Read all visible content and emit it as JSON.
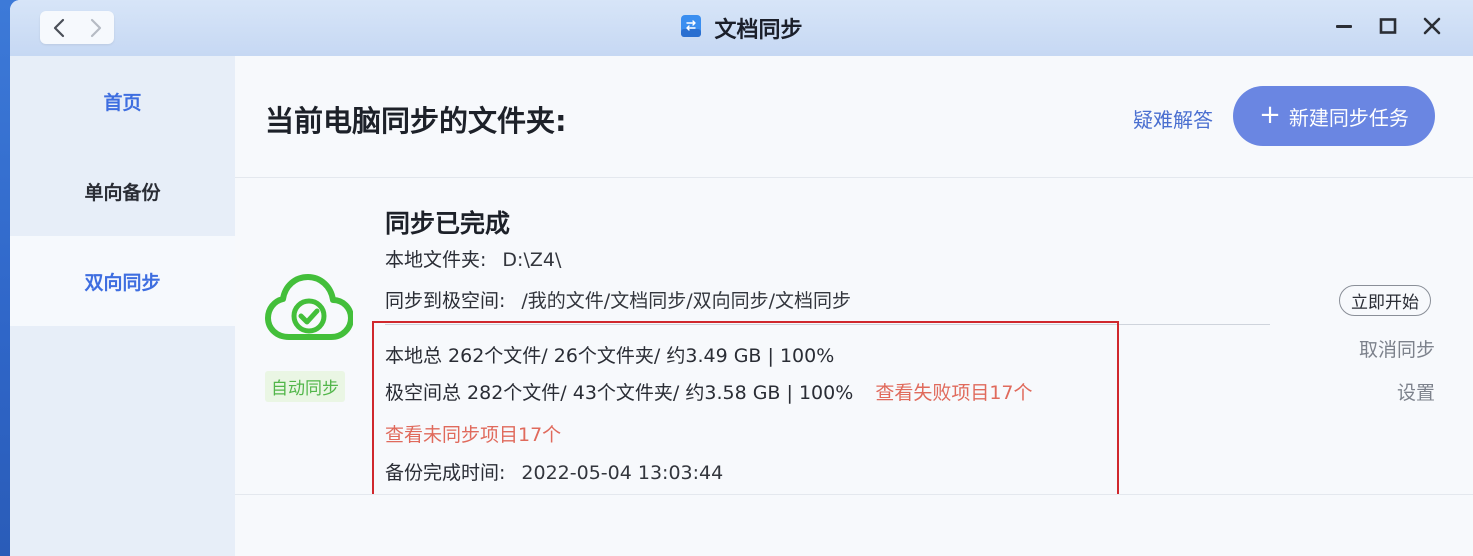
{
  "window": {
    "title": "文档同步",
    "icons": {
      "back": "chevron-left-icon",
      "forward": "chevron-right-icon",
      "app": "document-sync-app-icon",
      "minimize": "minimize-icon",
      "maximize": "maximize-icon",
      "close": "close-icon"
    }
  },
  "sidebar": {
    "items": [
      {
        "label": "首页",
        "color": "#3e6ee0",
        "active": false
      },
      {
        "label": "单向备份",
        "color": "#2a2d35",
        "active": false
      },
      {
        "label": "双向同步",
        "color": "#3e6ee0",
        "active": true
      }
    ]
  },
  "header": {
    "title": "当前电脑同步的文件夹:",
    "faq_label": "疑难解答",
    "new_task_label": "新建同步任务",
    "new_task_icon": "plus-icon"
  },
  "task": {
    "status_icon": "cloud-check-icon",
    "status_title": "同步已完成",
    "auto_badge": "自动同步",
    "local_folder_label": "本地文件夹:",
    "local_folder_value": "D:\\Z4\\",
    "remote_label": "同步到极空间:",
    "remote_value": "/我的文件/文档同步/双向同步/文档同步",
    "local_stats": "本地总 262个文件/ 26个文件夹/ 约3.49 GB | 100%",
    "remote_stats": "极空间总 282个文件/ 43个文件夹/ 约3.58 GB | 100%",
    "failed_link": "查看失败项目17个",
    "unsynced_link": "查看未同步项目17个",
    "completed_label": "备份完成时间:",
    "completed_value": "2022-05-04 13:03:44",
    "actions": {
      "start": "立即开始",
      "cancel": "取消同步",
      "settings": "设置"
    }
  },
  "colors": {
    "accent": "#6a86e2",
    "sidebar_active_text": "#3e6ee0",
    "success_green": "#52b64a",
    "link_red": "#e06a5c",
    "highlight_box": "#d0282d"
  }
}
